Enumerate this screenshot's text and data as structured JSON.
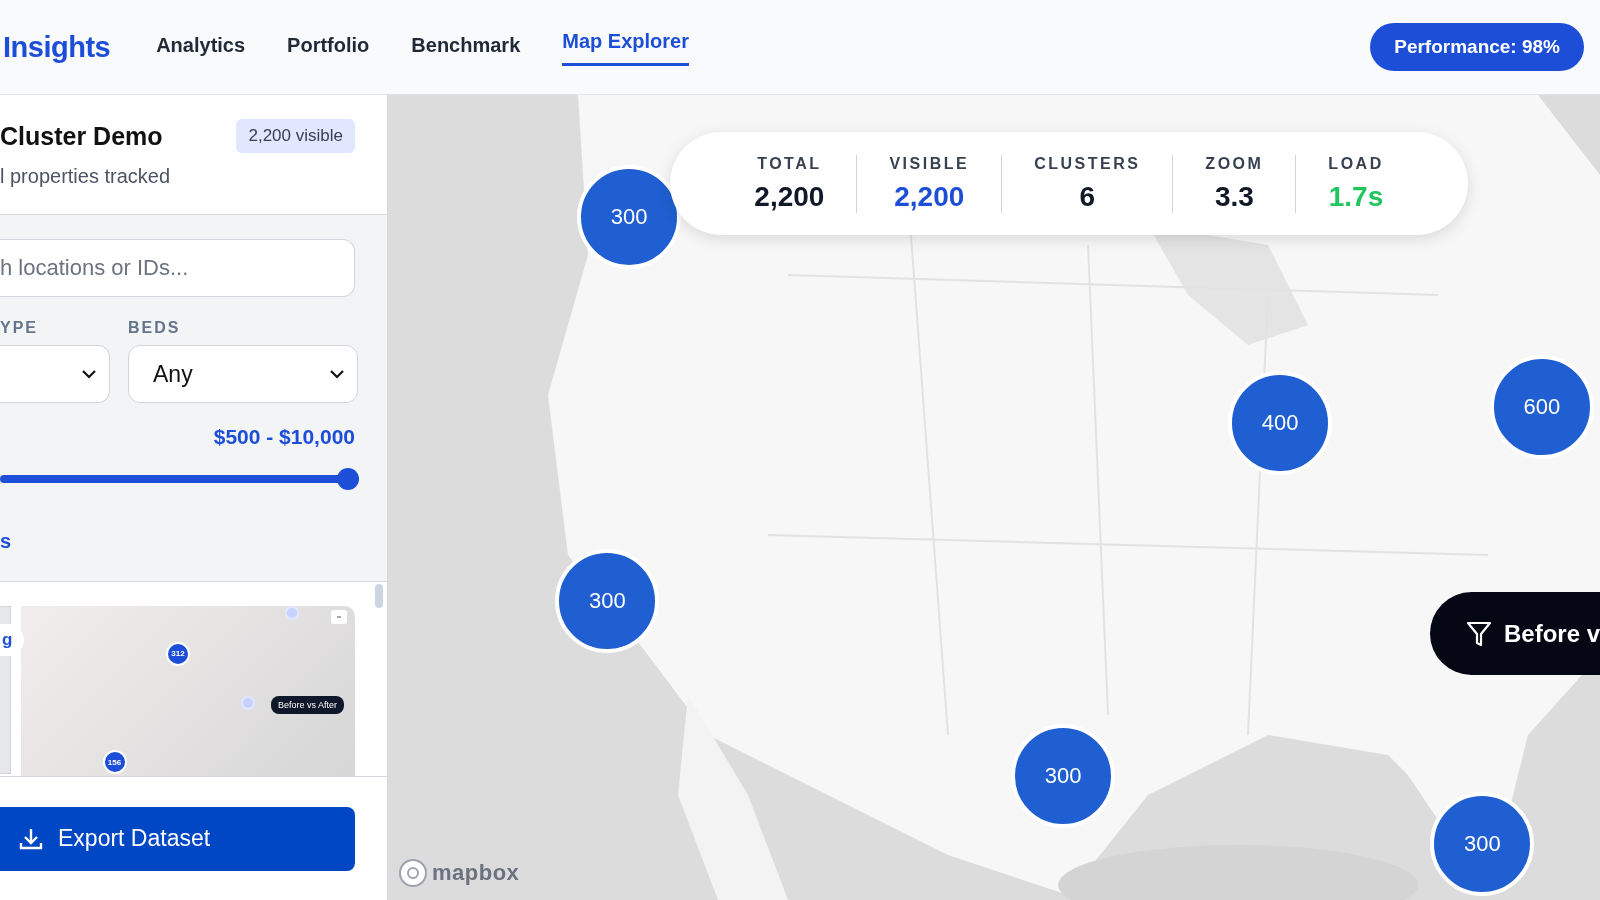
{
  "header": {
    "brand": "Insights",
    "tabs": [
      {
        "label": "Analytics",
        "selected": false
      },
      {
        "label": "Portfolio",
        "selected": false
      },
      {
        "label": "Benchmark",
        "selected": false
      },
      {
        "label": "Map Explorer",
        "selected": true
      }
    ],
    "performance": "Performance: 98%"
  },
  "sidebar": {
    "title": "Cluster Demo",
    "badge": "2,200 visible",
    "subtitle": "l properties tracked",
    "search": {
      "placeholder": "h locations or IDs..."
    },
    "filters": [
      {
        "label": "YPE"
      },
      {
        "label": "BEDS",
        "value": "Any"
      }
    ],
    "price": {
      "reading": "$500 - $10,000",
      "level": 1
    },
    "link": "s",
    "preview": {
      "chip": "g",
      "markers": [
        {
          "label": "312",
          "kind": "large"
        },
        {
          "label": "156",
          "kind": "large"
        },
        {
          "kind": "small"
        },
        {
          "kind": "small"
        }
      ],
      "button": "Before vs After"
    },
    "export": "Export Dataset"
  },
  "map": {
    "stats": [
      {
        "label": "TOTAL",
        "value": "2,200",
        "color": "#111827"
      },
      {
        "label": "VISIBLE",
        "value": "2,200",
        "color": "#1d4ed8"
      },
      {
        "label": "CLUSTERS",
        "value": "6",
        "color": "#111827"
      },
      {
        "label": "ZOOM",
        "value": "3.3",
        "color": "#111827"
      },
      {
        "label": "LOAD",
        "value": "1.7s",
        "color": "#22c55e"
      }
    ],
    "clusters": [
      {
        "count": "300"
      },
      {
        "count": "400"
      },
      {
        "count": "600"
      },
      {
        "count": "300"
      },
      {
        "count": "300"
      },
      {
        "count": "300"
      }
    ],
    "filter_button": "Before v",
    "attribution": "mapbox"
  }
}
